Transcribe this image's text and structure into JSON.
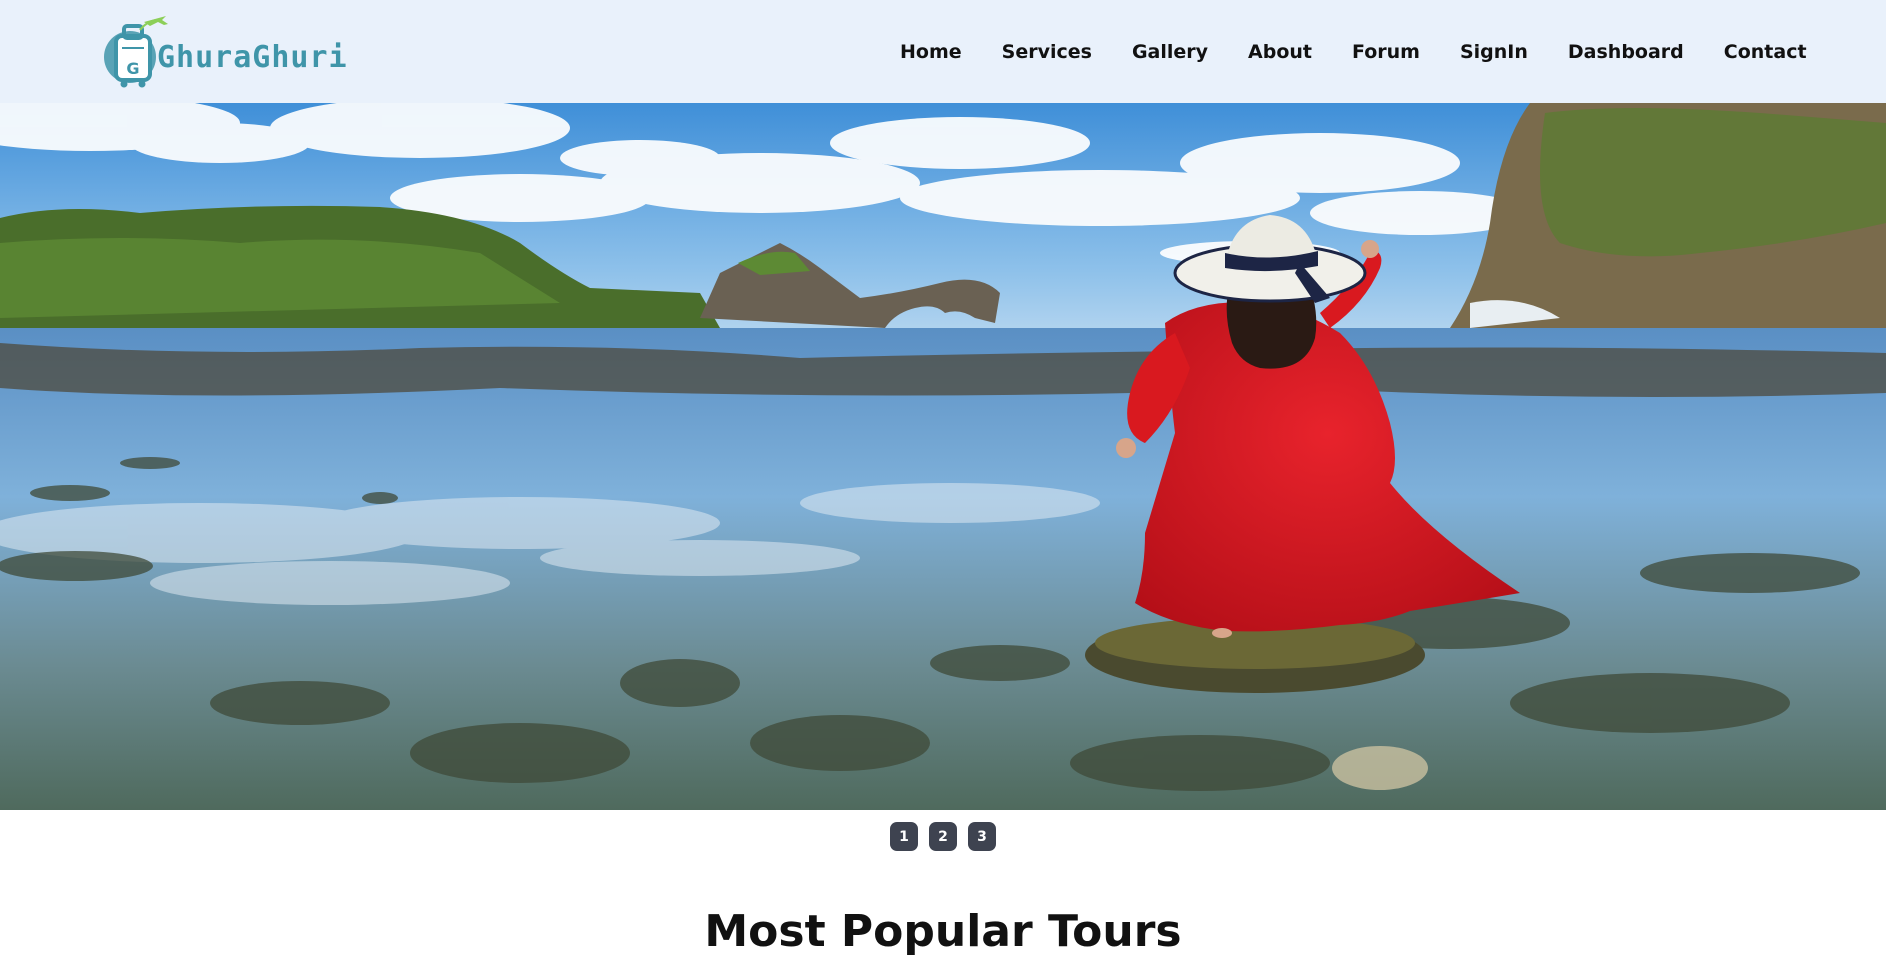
{
  "brand": {
    "name": "GhuraGhuri",
    "colors": {
      "primary": "#3f95a9",
      "accent": "#8ccf58",
      "header_bg": "#e9f1fb"
    },
    "icon": "suitcase-airplane-logo"
  },
  "nav": {
    "items": [
      {
        "label": "Home"
      },
      {
        "label": "Services"
      },
      {
        "label": "Gallery"
      },
      {
        "label": "About"
      },
      {
        "label": "Forum"
      },
      {
        "label": "SignIn"
      },
      {
        "label": "Dashboard"
      },
      {
        "label": "Contact"
      }
    ]
  },
  "hero": {
    "image": "woman-in-red-dress-at-rocky-beach-photo"
  },
  "slider": {
    "buttons": [
      {
        "label": "1"
      },
      {
        "label": "2"
      },
      {
        "label": "3"
      }
    ]
  },
  "sections": {
    "popular_title": "Most Popular Tours"
  }
}
